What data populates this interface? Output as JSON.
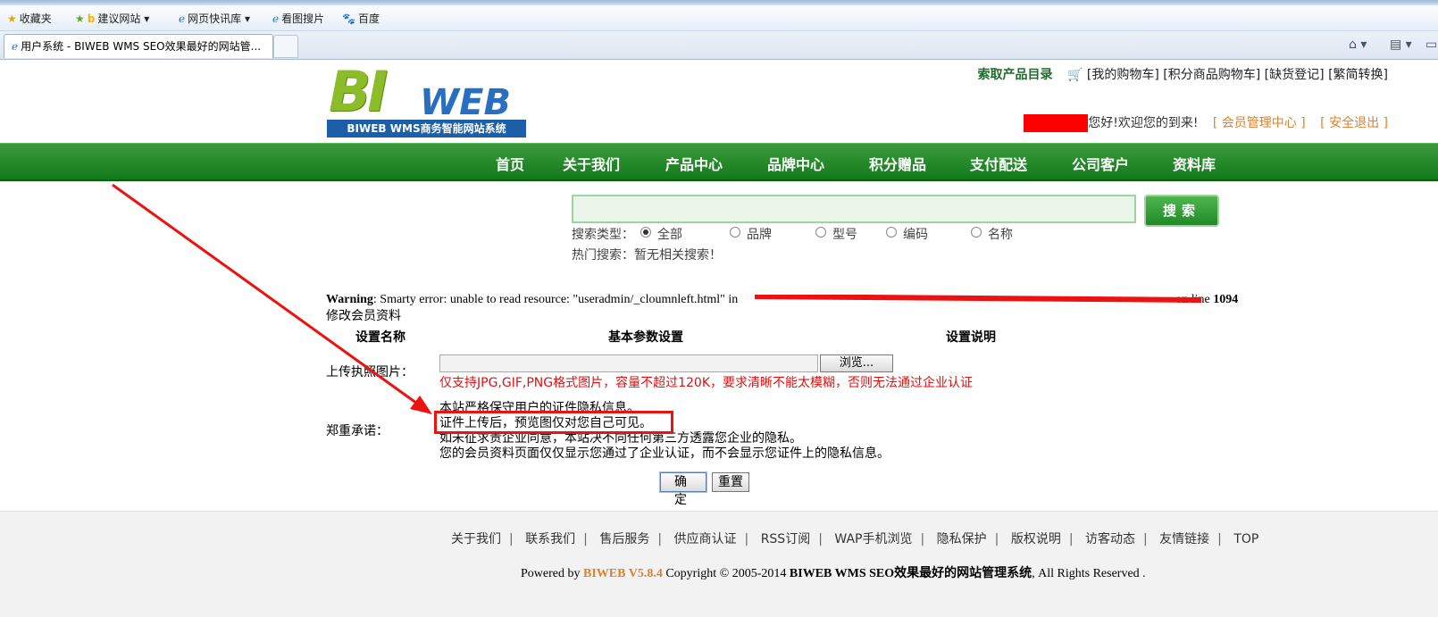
{
  "favbar": {
    "favorites": "收藏夹",
    "suggested": "建议网站",
    "quicknews": "网页快讯库",
    "imgsearch": "看图搜片",
    "baidu": "百度"
  },
  "tab": {
    "title": "用户系统 - BIWEB WMS SEO效果最好的网站管..."
  },
  "logo": {
    "brand": "BI",
    "brand2": "WEB",
    "tagline": "BIWEB WMS商务智能网站系统"
  },
  "toplinks": {
    "catalog": "索取产品目录",
    "cart": "[我的购物车]",
    "points_cart": "[积分商品购物车]",
    "stockout": "[缺货登记]",
    "convert": "[繁简转换]"
  },
  "welcome": {
    "greeting": "您好!欢迎您的到来!",
    "member_center": "[ 会员管理中心 ]",
    "logout": "[ 安全退出 ]"
  },
  "nav": [
    "首页",
    "关于我们",
    "产品中心",
    "品牌中心",
    "积分赠品",
    "支付配送",
    "公司客户",
    "资料库"
  ],
  "search": {
    "button": "搜索",
    "type_label": "搜索类型：",
    "options": [
      "全部",
      "品牌",
      "型号",
      "编码",
      "名称"
    ],
    "selected": "全部",
    "hot_label": "热门搜索：",
    "hot_value": "暂无相关搜索！"
  },
  "warning": {
    "label": "Warning",
    "text": ": Smarty error: unable to read resource: \"useradmin/_cloumnleft.html\" in",
    "line_text": "on line",
    "line_no": "1094"
  },
  "form": {
    "title": "修改会员资料",
    "headers": [
      "设置名称",
      "基本参数设置",
      "设置说明"
    ],
    "upload_label": "上传执照图片：",
    "browse": "浏览...",
    "upload_hint": "仅支持JPG,GIF,PNG格式图片，容量不超过120K，要求清晰不能太模糊，否则无法通过企业认证",
    "promise_label": "郑重承诺：",
    "promise_lines": [
      "本站严格保守用户的证件隐私信息。",
      "证件上传后，预览图仅对您自己可见。",
      "如未征求贵企业同意，本站决不向任何第三方透露您企业的隐私。",
      "您的会员资料页面仅仅显示您通过了企业认证，而不会显示您证件上的隐私信息。"
    ],
    "ok": "确 定",
    "reset": "重置"
  },
  "footer": {
    "links": [
      "关于我们",
      "联系我们",
      "售后服务",
      "供应商认证",
      "RSS订阅",
      "WAP手机浏览",
      "隐私保护",
      "版权说明",
      "访客动态",
      "友情链接",
      "TOP"
    ],
    "powered_by": "Powered by",
    "brand": "BIWEB V5.8.4",
    "copyright": "Copyright © 2005-2014",
    "copyright_bold": "BIWEB WMS SEO效果最好的网站管理系统",
    "rights": ", All Rights Reserved ."
  },
  "colors": {
    "nav_green": "#1f8a25",
    "annotation_red": "#ee1111",
    "accent_orange": "#e0802a"
  }
}
